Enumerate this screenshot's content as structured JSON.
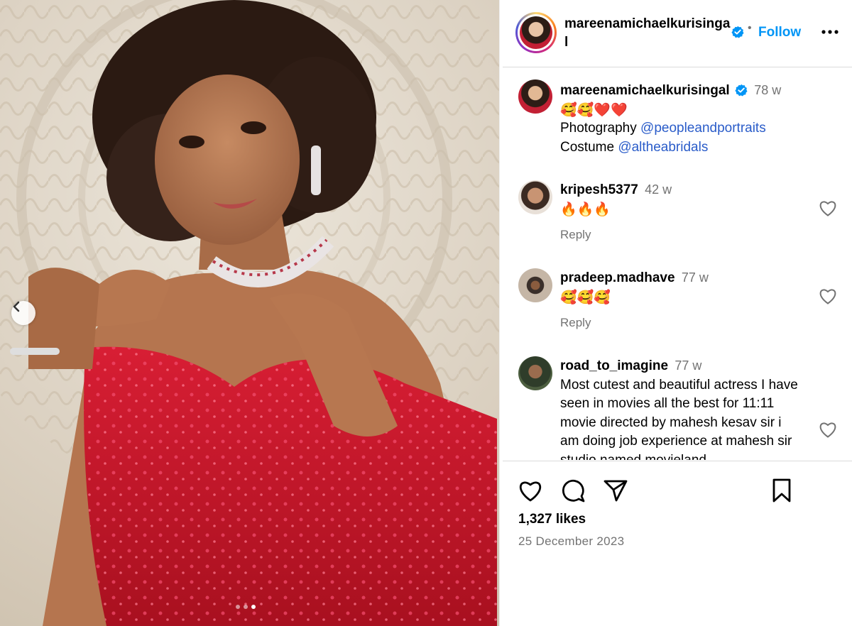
{
  "post": {
    "author": "mareenamichaelkurisingal",
    "follow_label": "Follow",
    "separator": "•",
    "likes": "1,327 likes",
    "date": "25 December 2023",
    "carousel": {
      "total": 3,
      "active": 3
    }
  },
  "caption": {
    "username": "mareenamichaelkurisingal",
    "time": "78 w",
    "emoji_line": "🥰🥰❤️❤️",
    "photo_label": "Photography ",
    "photo_mention": "@peopleandportraits",
    "costume_label": "Costume ",
    "costume_mention": "@altheabridals"
  },
  "comments": [
    {
      "username": "kripesh5377",
      "time": "42 w",
      "text": "🔥🔥🔥",
      "reply": "Reply"
    },
    {
      "username": "pradeep.madhave",
      "time": "77 w",
      "text": "🥰🥰🥰",
      "reply": "Reply"
    },
    {
      "username": "road_to_imagine",
      "time": "77 w",
      "text": "Most cutest and beautiful actress I have seen in movies all the best for 11:11 movie directed by mahesh kesav sir i am doing job experience at mahesh sir studio named movieland"
    }
  ],
  "icons": {
    "verified": "verified-badge-icon",
    "more": "more-options-icon",
    "like": "heart-icon",
    "comment": "comment-icon",
    "share": "share-icon",
    "save": "bookmark-icon",
    "prev": "chevron-left-icon"
  },
  "colors": {
    "accent": "#0095f6",
    "mention": "#2a5cc9",
    "muted": "#737373",
    "dress": "#c0182c"
  }
}
